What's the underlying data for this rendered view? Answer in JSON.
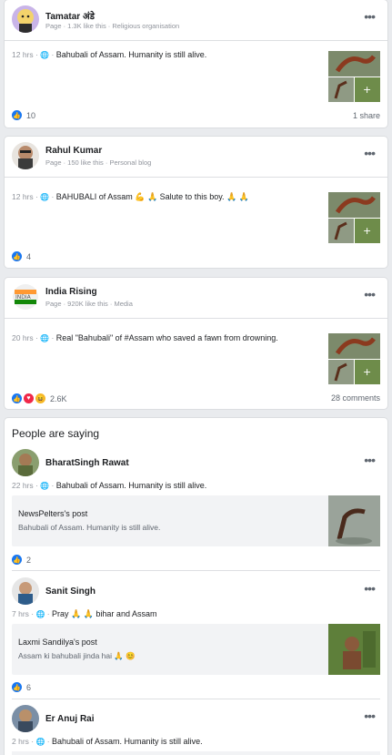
{
  "posts": [
    {
      "name": "Tamatar अंडे",
      "meta": "Page · 1.3K like this · Religious organisation",
      "time": "12 hrs",
      "text": "Bahubali of Assam. Humanity is still alive.",
      "reactions": "10",
      "right_stat": "1 share"
    },
    {
      "name": "Rahul Kumar",
      "meta": "Page · 150 like this · Personal blog",
      "time": "12 hrs",
      "text": "BAHUBALI of Assam 💪 🙏 Salute to this boy. 🙏 🙏",
      "reactions": "4",
      "right_stat": ""
    },
    {
      "name": "India Rising",
      "meta": "Page · 920K like this · Media",
      "time": "20 hrs",
      "text": "Real \"Bahubali\" of #Assam who saved a fawn from drowning.",
      "reactions": "2.6K",
      "right_stat": "28 comments"
    }
  ],
  "people_saying": {
    "title": "People are saying",
    "items": [
      {
        "name": "BharatSingh Rawat",
        "time": "22 hrs",
        "text": "Bahubali of Assam. Humanity is still alive.",
        "shared_title": "NewsPelters's post",
        "shared_body": "Bahubali of Assam. Humanity is still alive.",
        "reactions": "2"
      },
      {
        "name": "Sanit Singh",
        "time": "7 hrs",
        "text": "Pray 🙏 🙏 bihar and Assam",
        "shared_title": "Laxmi Sandilya's post",
        "shared_body": "Assam ki bahubali jinda hai 🙏 😊",
        "reactions": "6"
      },
      {
        "name": "Er Anuj Rai",
        "time": "2 hrs",
        "text": "Bahubali of Assam. Humanity is still alive."
      }
    ]
  },
  "colors": {
    "like": "#1877f2",
    "bg": "#e9ebee",
    "meta": "#90949c"
  },
  "icons": {
    "more": "more-options-icon",
    "globe": "globe-icon",
    "like": "like-icon"
  },
  "glyphs": {
    "more": "•••",
    "sep": " · ",
    "like": "👍",
    "love": "♥",
    "haha": "😆",
    "globe": "🌐"
  }
}
